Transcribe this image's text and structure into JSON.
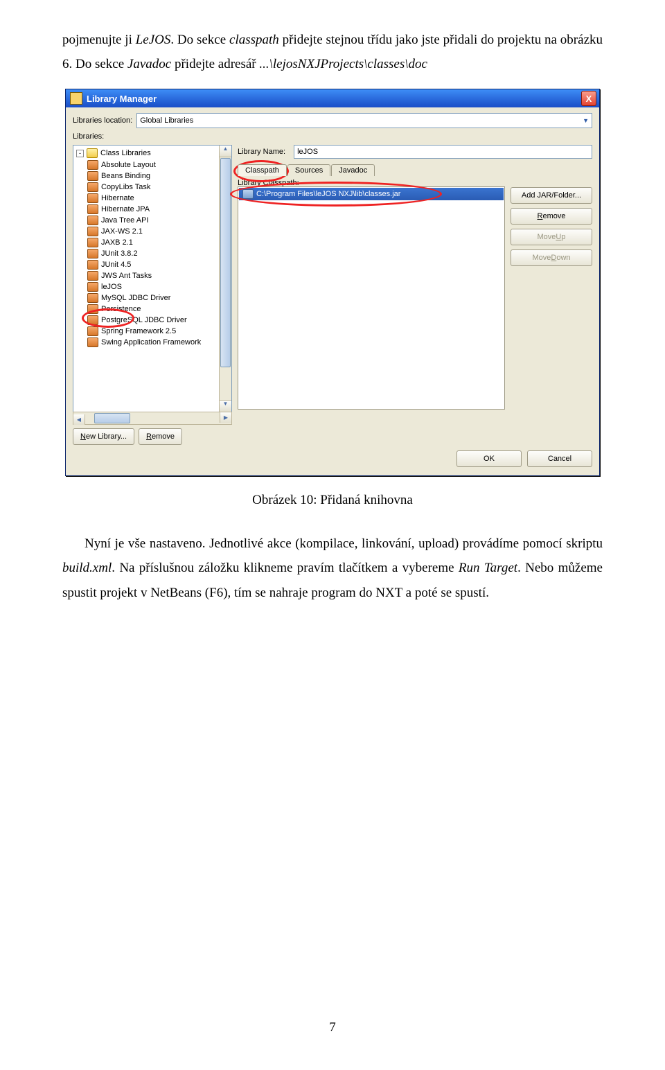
{
  "para1_a": "pojmenujte ji ",
  "para1_b": "LeJOS",
  "para1_c": ". Do sekce ",
  "para1_d": "classpath",
  "para1_e": " přidejte stejnou třídu jako jste přidali do projektu na obrázku 6. Do sekce ",
  "para1_f": "Javadoc",
  "para1_g": " přidejte adresář ",
  "para1_h": "...\\lejosNXJProjects\\classes\\doc",
  "dialog": {
    "title": "Library Manager",
    "close": "X",
    "librariesLocationLabel": "Libraries location:",
    "librariesLocationValue": "Global Libraries",
    "librariesLabel": "Libraries:",
    "classLibraries": "Class Libraries",
    "items": [
      "Absolute Layout",
      "Beans Binding",
      "CopyLibs Task",
      "Hibernate",
      "Hibernate JPA",
      "Java Tree API",
      "JAX-WS 2.1",
      "JAXB 2.1",
      "JUnit 3.8.2",
      "JUnit 4.5",
      "JWS Ant Tasks",
      "leJOS",
      "MySQL JDBC Driver",
      "Persistence",
      "PostgreSQL JDBC Driver",
      "Spring Framework 2.5",
      "Swing Application Framework"
    ],
    "newLibrary": "New Library...",
    "remove": "Remove",
    "libraryNameLabel": "Library Name:",
    "libraryNameValue": "leJOS",
    "tabs": {
      "classpath": "Classpath",
      "sources": "Sources",
      "javadoc": "Javadoc"
    },
    "libraryClasspathLabel": "Library Classpath:",
    "classpathEntry": "C:\\Program Files\\leJOS NXJ\\lib\\classes.jar",
    "addJar": "Add JAR/Folder...",
    "removeR": "Remove",
    "moveUp": "Move Up",
    "moveDown": "Move Down",
    "ok": "OK",
    "cancel": "Cancel"
  },
  "caption": "Obrázek 10: Přidaná knihovna",
  "para2_a": "Nyní je vše nastaveno. Jednotlivé akce (kompilace, linkování, upload) provádíme pomocí skriptu ",
  "para2_b": "build.xml",
  "para2_c": ". Na příslušnou záložku klikneme pravím tlačítkem a vybereme ",
  "para2_d": "Run Target",
  "para2_e": ". Nebo můžeme spustit projekt v NetBeans (F6), tím se nahraje program do NXT a poté se spustí.",
  "pagenum": "7"
}
